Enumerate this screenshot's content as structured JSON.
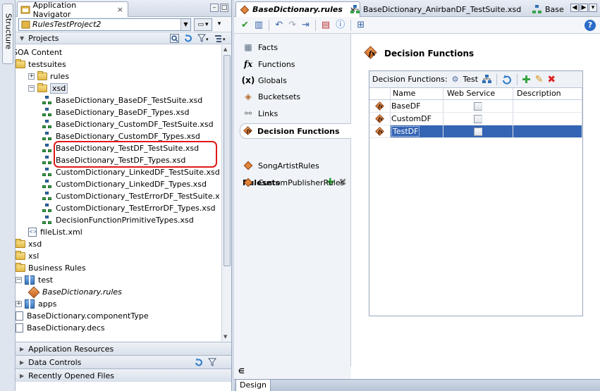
{
  "side_tab": {
    "label": "Structure"
  },
  "navigator": {
    "tab_title": "Application Navigator",
    "project_name": "RulesTestProject2",
    "projects_label": "Projects",
    "tree": [
      {
        "label": "SOA Content",
        "indent": 0,
        "icon": "none",
        "expander": "none",
        "partial": true
      },
      {
        "label": "testsuites",
        "indent": 0,
        "icon": "folder",
        "expander": "none"
      },
      {
        "label": "rules",
        "indent": 1,
        "icon": "folder",
        "expander": "+"
      },
      {
        "label": "xsd",
        "indent": 1,
        "icon": "folder",
        "expander": "-",
        "selected": true
      },
      {
        "label": "BaseDictionary_BaseDF_TestSuite.xsd",
        "indent": 2,
        "icon": "xsd"
      },
      {
        "label": "BaseDictionary_BaseDF_Types.xsd",
        "indent": 2,
        "icon": "xsd"
      },
      {
        "label": "BaseDictionary_CustomDF_TestSuite.xsd",
        "indent": 2,
        "icon": "xsd"
      },
      {
        "label": "BaseDictionary_CustomDF_Types.xsd",
        "indent": 2,
        "icon": "xsd"
      },
      {
        "label": "BaseDictionary_TestDF_TestSuite.xsd",
        "indent": 2,
        "icon": "xsd"
      },
      {
        "label": "BaseDictionary_TestDF_Types.xsd",
        "indent": 2,
        "icon": "xsd"
      },
      {
        "label": "CustomDictionary_LinkedDF_TestSuite.xsd",
        "indent": 2,
        "icon": "xsd"
      },
      {
        "label": "CustomDictionary_LinkedDF_Types.xsd",
        "indent": 2,
        "icon": "xsd"
      },
      {
        "label": "CustomDictionary_TestErrorDF_TestSuite.x",
        "indent": 2,
        "icon": "xsd"
      },
      {
        "label": "CustomDictionary_TestErrorDF_Types.xsd",
        "indent": 2,
        "icon": "xsd"
      },
      {
        "label": "DecisionFunctionPrimitiveTypes.xsd",
        "indent": 2,
        "icon": "xsd"
      },
      {
        "label": "fileList.xml",
        "indent": 1,
        "icon": "xml"
      },
      {
        "label": "xsd",
        "indent": 0,
        "icon": "folder"
      },
      {
        "label": "xsl",
        "indent": 0,
        "icon": "folder"
      },
      {
        "label": "Business Rules",
        "indent": 0,
        "icon": "folder"
      },
      {
        "label": "test",
        "indent": 0,
        "icon": "project",
        "expander": "-"
      },
      {
        "label": "BaseDictionary.rules",
        "indent": 1,
        "icon": "rules",
        "italic": true
      },
      {
        "label": "apps",
        "indent": 0,
        "icon": "project",
        "expander": "+"
      },
      {
        "label": "BaseDictionary.componentType",
        "indent": 0,
        "icon": "doc"
      },
      {
        "label": "BaseDictionary.decs",
        "indent": 0,
        "icon": "doc"
      }
    ],
    "accordions": [
      "Application Resources",
      "Data Controls",
      "Recently Opened Files"
    ]
  },
  "editor": {
    "tabs": [
      {
        "label": "BaseDictionary.rules",
        "active": true
      },
      {
        "label": "BaseDictionary_AnirbanDF_TestSuite.xsd",
        "active": false
      },
      {
        "label": "Base",
        "active": false
      }
    ],
    "sections": [
      {
        "label": "Facts",
        "icon": "facts"
      },
      {
        "label": "Functions",
        "icon": "fx"
      },
      {
        "label": "Globals",
        "icon": "x-paren"
      },
      {
        "label": "Bucketsets",
        "icon": "bucket"
      },
      {
        "label": "Links",
        "icon": "link"
      },
      {
        "label": "Decision Functions",
        "icon": "decision",
        "active": true
      }
    ],
    "rulesets_label": "Rulesets",
    "rulesets": [
      "SongArtistRules",
      "CustomPublisherRules"
    ],
    "main_title": "Decision Functions",
    "panel_label": "Decision Functions:",
    "test_label": "Test",
    "columns": [
      "Name",
      "Web Service",
      "Description"
    ],
    "rows": [
      {
        "name": "BaseDF",
        "web_service": false,
        "description": "",
        "selected": false
      },
      {
        "name": "CustomDF",
        "web_service": false,
        "description": "",
        "selected": false
      },
      {
        "name": "TestDF",
        "web_service": false,
        "description": "",
        "selected": true
      }
    ],
    "bottom_tab": "Design"
  }
}
